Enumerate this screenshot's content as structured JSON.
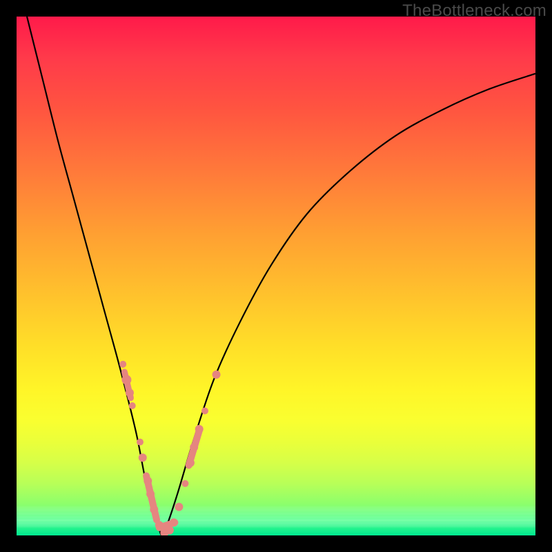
{
  "watermark": "TheBottleneck.com",
  "colors": {
    "frame_bg": "#000000",
    "curve": "#000000",
    "marker": "#e58580"
  },
  "chart_data": {
    "type": "line",
    "title": "",
    "xlabel": "",
    "ylabel": "",
    "xlim": [
      0,
      100
    ],
    "ylim": [
      0,
      100
    ],
    "curve": {
      "description": "V-shaped bottleneck curve, minimum near x≈28",
      "x": [
        2,
        5,
        8,
        11,
        14,
        17,
        20,
        23,
        25,
        27,
        28,
        29,
        31,
        34,
        38,
        43,
        49,
        56,
        64,
        73,
        82,
        91,
        100
      ],
      "y": [
        100,
        88,
        76,
        65,
        54,
        43,
        32,
        20,
        10,
        3,
        0,
        2,
        8,
        18,
        30,
        41,
        52,
        62,
        70,
        77,
        82,
        86,
        89
      ]
    },
    "markers": {
      "description": "salmon-pink bead clusters along lower portion of curve near minimum",
      "points": [
        {
          "x": 20.5,
          "y": 33,
          "r": 5
        },
        {
          "x": 21.2,
          "y": 30,
          "r": 7
        },
        {
          "x": 21.8,
          "y": 27.5,
          "r": 6
        },
        {
          "x": 22.3,
          "y": 25,
          "r": 5
        },
        {
          "x": 23.8,
          "y": 18,
          "r": 5
        },
        {
          "x": 24.3,
          "y": 15,
          "r": 6
        },
        {
          "x": 25.3,
          "y": 10.5,
          "r": 6
        },
        {
          "x": 25.8,
          "y": 8,
          "r": 6
        },
        {
          "x": 26.5,
          "y": 5,
          "r": 6
        },
        {
          "x": 27.5,
          "y": 2,
          "r": 6
        },
        {
          "x": 28.5,
          "y": 0.5,
          "r": 6
        },
        {
          "x": 29.5,
          "y": 1,
          "r": 6
        },
        {
          "x": 30.3,
          "y": 2.5,
          "r": 6
        },
        {
          "x": 31.3,
          "y": 5.5,
          "r": 6
        },
        {
          "x": 32.5,
          "y": 10,
          "r": 5
        },
        {
          "x": 33.5,
          "y": 14,
          "r": 6
        },
        {
          "x": 34.2,
          "y": 17,
          "r": 6
        },
        {
          "x": 35.2,
          "y": 20.5,
          "r": 6
        },
        {
          "x": 36.3,
          "y": 24,
          "r": 5
        },
        {
          "x": 38.5,
          "y": 31,
          "r": 6
        }
      ]
    }
  }
}
